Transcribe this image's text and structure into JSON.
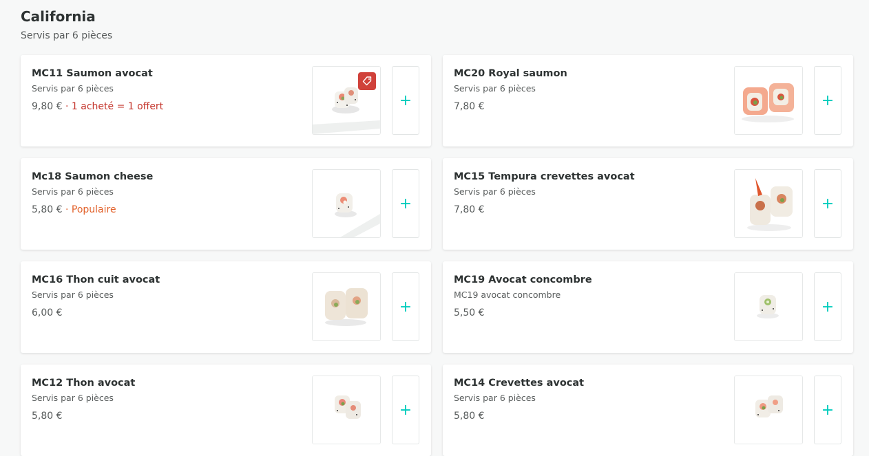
{
  "section": {
    "title": "California",
    "subtitle": "Servis par 6 pièces"
  },
  "add_label": "+",
  "items": [
    {
      "name": "MC11 Saumon avocat",
      "desc": "Servis par 6 pièces",
      "price": "9,80 €",
      "tag_sep": " · ",
      "tag": "1 acheté = 1 offert",
      "tag_type": "offer",
      "promo_icon": "tag-icon"
    },
    {
      "name": "MC20 Royal saumon",
      "desc": "Servis par 6 pièces",
      "price": "7,80 €"
    },
    {
      "name": "Mc18 Saumon cheese",
      "desc": "Servis par 6 pièces",
      "price": "5,80 €",
      "tag_sep": " · ",
      "tag": "Populaire",
      "tag_type": "popular"
    },
    {
      "name": "MC15 Tempura crevettes avocat",
      "desc": "Servis par 6 pièces",
      "price": "7,80 €"
    },
    {
      "name": "MC16 Thon cuit avocat",
      "desc": "Servis par 6 pièces",
      "price": "6,00 €"
    },
    {
      "name": "MC19 Avocat concombre",
      "desc": "MC19 avocat concombre",
      "price": "5,50 €"
    },
    {
      "name": "MC12 Thon avocat",
      "desc": "Servis par 6 pièces",
      "price": "5,80 €"
    },
    {
      "name": "MC14 Crevettes avocat",
      "desc": "Servis par 6 pièces",
      "price": "5,80 €"
    }
  ],
  "colors": {
    "accent": "#00ccbc",
    "offer": "#c4352c",
    "popular": "#e2612a"
  }
}
